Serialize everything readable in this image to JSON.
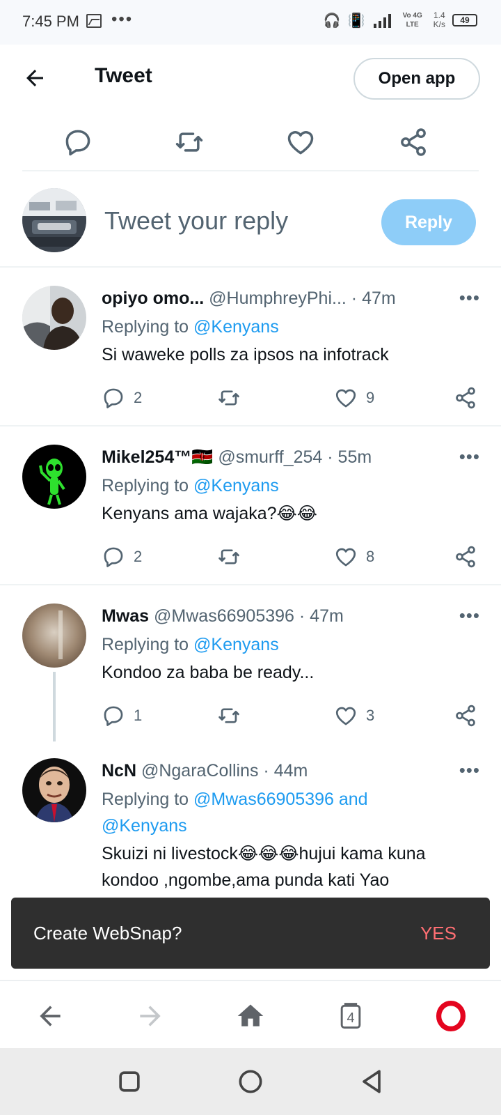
{
  "status_bar": {
    "time": "7:45 PM",
    "more": "•••",
    "speed_value": "1.4",
    "speed_unit": "K/s",
    "battery": "49",
    "network": "Vo 4G LTE"
  },
  "header": {
    "title": "Tweet",
    "open_app_label": "Open app"
  },
  "composer": {
    "placeholder": "Tweet your reply",
    "reply_label": "Reply"
  },
  "tweets": [
    {
      "name": "opiyo omo...",
      "handle": "@HumphreyPhi...",
      "time": "· 47m",
      "replying_prefix": "Replying to",
      "replying_to": "@Kenyans",
      "text": "Si waweke polls za ipsos na infotrack",
      "replies": "2",
      "likes": "9"
    },
    {
      "name": "Mikel254™🇰🇪",
      "handle": "@smurff_254",
      "time": "· 55m",
      "replying_prefix": "Replying to",
      "replying_to": "@Kenyans",
      "text": "Kenyans ama wajaka?😂😂",
      "replies": "2",
      "likes": "8"
    },
    {
      "name": "Mwas",
      "handle": "@Mwas66905396",
      "time": "· 47m",
      "replying_prefix": "Replying to",
      "replying_to": "@Kenyans",
      "text": "Kondoo za baba be ready...",
      "replies": "1",
      "likes": "3"
    },
    {
      "name": "NcN",
      "handle": "@NgaraCollins",
      "time": "· 44m",
      "replying_prefix": "Replying to",
      "replying_to": "@Mwas66905396 and",
      "replying_to_2": "@Kenyans",
      "text_line1": "Skuizi ni livestock😂😂😂hujui kama kuna",
      "text_line2": "kondoo ,ngombe,ama punda kati Yao"
    }
  ],
  "snackbar": {
    "text": "Create WebSnap?",
    "action": "YES"
  },
  "browser_nav": {
    "tab_count": "4"
  },
  "colors": {
    "accent": "#1d9bf0",
    "reply_button": "#8ecdf8",
    "snackbar_bg": "#2f2f2f",
    "snackbar_action": "#ff6f73",
    "opera_red": "#e4051f"
  }
}
